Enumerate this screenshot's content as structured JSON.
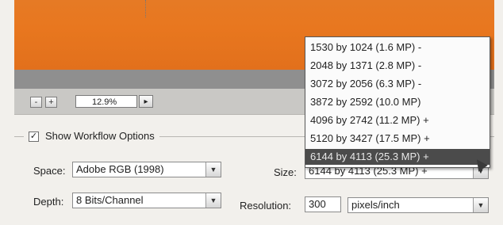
{
  "zoom": {
    "minus_label": "-",
    "plus_label": "+",
    "value": "12.9%",
    "menu_arrow": "▸"
  },
  "workflow": {
    "checkbox_checked": true,
    "check_glyph": "✓",
    "legend": "Show Workflow Options"
  },
  "space": {
    "label": "Space:",
    "value": "Adobe RGB (1998)"
  },
  "depth": {
    "label": "Depth:",
    "value": "8 Bits/Channel"
  },
  "size": {
    "label": "Size:",
    "value": "6144 by 4113  (25.3 MP)  +"
  },
  "resolution": {
    "label": "Resolution:",
    "value": "300",
    "unit": "pixels/inch"
  },
  "size_dropdown": {
    "items": [
      "1530 by 1024  (1.6 MP)  -",
      "2048 by 1371  (2.8 MP)  -",
      "3072 by 2056  (6.3 MP)  -",
      "3872 by 2592  (10.0 MP)",
      "4096 by 2742  (11.2 MP)  +",
      "5120 by 3427  (17.5 MP)  +",
      "6144 by 4113  (25.3 MP)  +"
    ],
    "selected_index": 6
  },
  "colors": {
    "preview": "#e8771f",
    "selected_row": "#4b4b4b"
  }
}
